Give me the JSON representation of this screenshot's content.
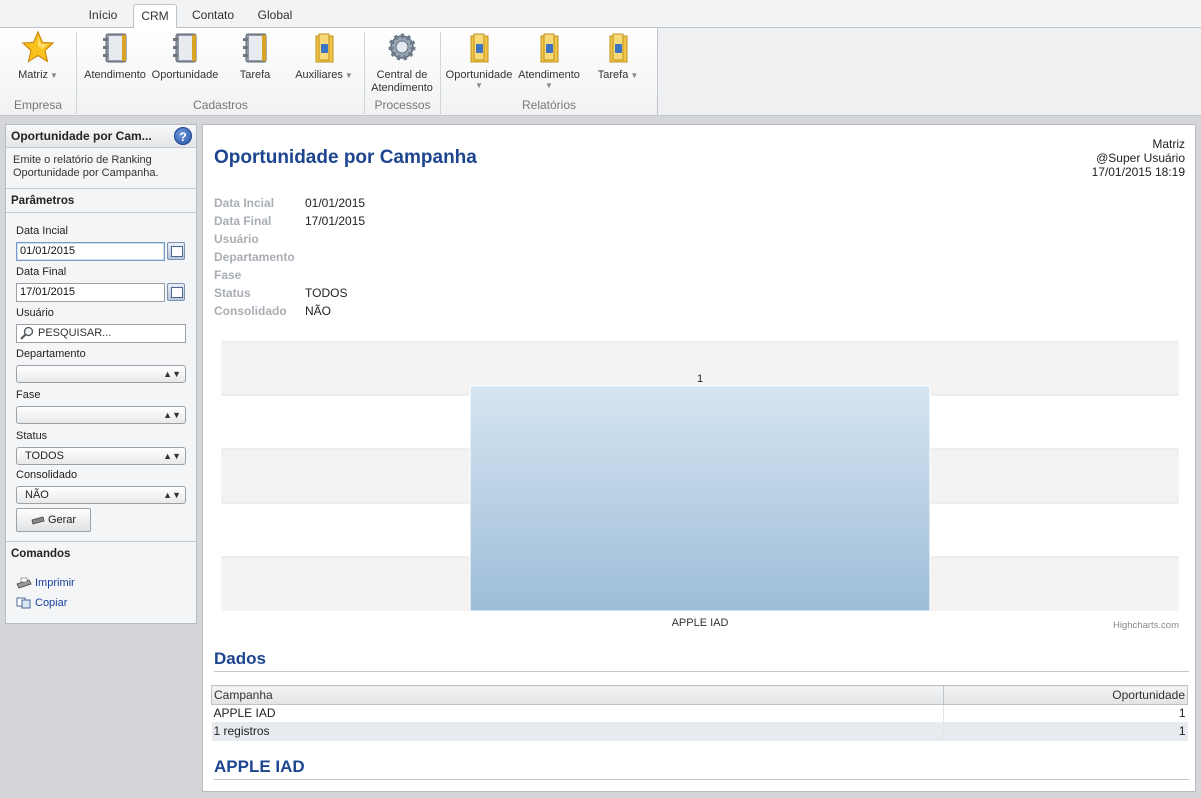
{
  "tabs": [
    {
      "label": "Início",
      "active": false
    },
    {
      "label": "CRM",
      "active": true
    },
    {
      "label": "Contato",
      "active": false
    },
    {
      "label": "Global",
      "active": false
    }
  ],
  "ribbon": {
    "groups": [
      {
        "label": "Empresa"
      },
      {
        "label": "Cadastros"
      },
      {
        "label": "Processos"
      },
      {
        "label": "Relatórios"
      }
    ],
    "buttons": {
      "matriz": "Matriz",
      "atendimento": "Atendimento",
      "oportunidade": "Oportunidade",
      "tarefa": "Tarefa",
      "auxiliares": "Auxiliares",
      "central_line1": "Central de",
      "central_line2": "Atendimento",
      "rel_oportunidade": "Oportunidade",
      "rel_atendimento": "Atendimento",
      "rel_tarefa": "Tarefa"
    }
  },
  "panel": {
    "title": "Oportunidade por Cam...",
    "help": "?",
    "description": "Emite o relatório de Ranking Oportunidade por Campanha.",
    "params_title": "Parâmetros",
    "fields": {
      "data_inicial_label": "Data Incial",
      "data_inicial_value": "01/01/2015",
      "data_final_label": "Data Final",
      "data_final_value": "17/01/2015",
      "usuario_label": "Usuário",
      "usuario_placeholder": "PESQUISAR...",
      "departamento_label": "Departamento",
      "departamento_value": "",
      "fase_label": "Fase",
      "fase_value": "",
      "status_label": "Status",
      "status_value": "TODOS",
      "consolidado_label": "Consolidado",
      "consolidado_value": "NÃO"
    },
    "gerar_label": "Gerar",
    "commands_title": "Comandos",
    "imprimir": "Imprimir",
    "copiar": "Copiar"
  },
  "report": {
    "title": "Oportunidade por Campanha",
    "meta": {
      "company": "Matriz",
      "user": "@Super Usuário",
      "datetime": "17/01/2015 18:19"
    },
    "params": [
      {
        "label": "Data Incial",
        "value": "01/01/2015"
      },
      {
        "label": "Data Final",
        "value": "17/01/2015"
      },
      {
        "label": "Usuário",
        "value": ""
      },
      {
        "label": "Departamento",
        "value": ""
      },
      {
        "label": "Fase",
        "value": ""
      },
      {
        "label": "Status",
        "value": "TODOS"
      },
      {
        "label": "Consolidado",
        "value": "NÃO"
      }
    ],
    "dados_title": "Dados",
    "table": {
      "headers": [
        "Campanha",
        "Oportunidade"
      ],
      "rows": [
        [
          "APPLE IAD",
          "1"
        ]
      ],
      "footer": [
        "1 registros",
        "1"
      ]
    },
    "section_title": "APPLE IAD"
  },
  "chart_data": {
    "type": "bar",
    "categories": [
      "APPLE IAD"
    ],
    "values": [
      1
    ],
    "ylim": [
      0,
      1.2
    ],
    "grid": true,
    "credit": "Highcharts.com",
    "colors": {
      "bar_top": "#d6e5f1",
      "bar_bottom": "#9dbdd8",
      "band": "#f3f3f3"
    }
  }
}
